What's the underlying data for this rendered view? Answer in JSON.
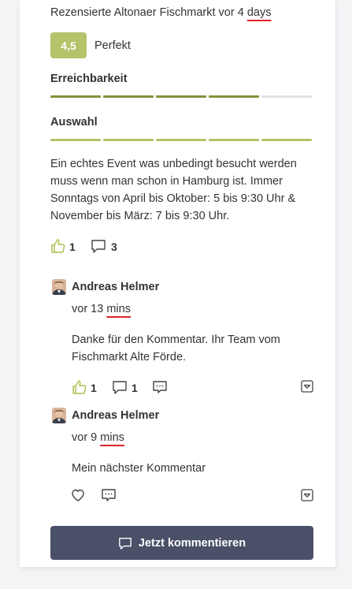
{
  "review": {
    "meta_prefix": "Rezensierte Altonaer Fischmarkt vor 4 ",
    "meta_unit": "days",
    "score": "4,5",
    "score_label": "Perfekt",
    "accent_color": "#b3c46a",
    "criteria": [
      {
        "label": "Erreichbarkeit",
        "rating": 4,
        "max": 5
      },
      {
        "label": "Auswahl",
        "rating": 5,
        "max": 5
      }
    ],
    "body": "Ein echtes Event was unbedingt besucht werden muss wenn man schon in Hamburg ist. Immer Sonntags von April bis Oktober: 5 bis 9:30 Uhr & November bis März: 7 bis 9:30 Uhr.",
    "likes": "1",
    "comments": "3",
    "like_icon": "thumbs-up-icon",
    "comment_icon": "speech-bubble-icon"
  },
  "comments": [
    {
      "author": "Andreas Helmer",
      "time_prefix": "vor 13 ",
      "time_unit": "mins",
      "text": "Danke für den Kommentar. Ihr Team vom Fischmarkt Alte Förde.",
      "likes": "1",
      "replies": "1"
    },
    {
      "author": "Andreas Helmer",
      "time_prefix": "vor 9 ",
      "time_unit": "mins",
      "text": "Mein nächster Kommentar"
    }
  ],
  "cta": {
    "label": "Jetzt kommentieren"
  }
}
